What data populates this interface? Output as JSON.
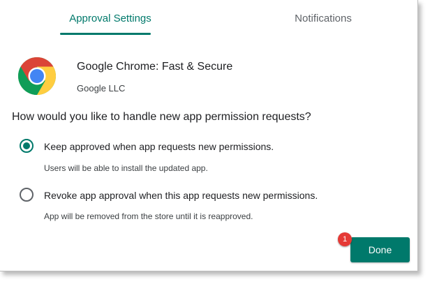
{
  "tabs": [
    {
      "label": "Approval Settings",
      "active": true
    },
    {
      "label": "Notifications",
      "active": false
    }
  ],
  "app": {
    "icon": "chrome-logo-icon",
    "name": "Google Chrome: Fast & Secure",
    "developer": "Google LLC"
  },
  "question": "How would you like to handle new app permission requests?",
  "options": [
    {
      "label": "Keep approved when app requests new permissions.",
      "description": "Users will be able to install the updated app.",
      "selected": true
    },
    {
      "label": "Revoke app approval when this app requests new permissions.",
      "description": "App will be removed from the store until it is reapproved.",
      "selected": false
    }
  ],
  "done_label": "Done",
  "callout_number": "1",
  "colors": {
    "accent": "#00796b",
    "callout": "#e53935"
  }
}
